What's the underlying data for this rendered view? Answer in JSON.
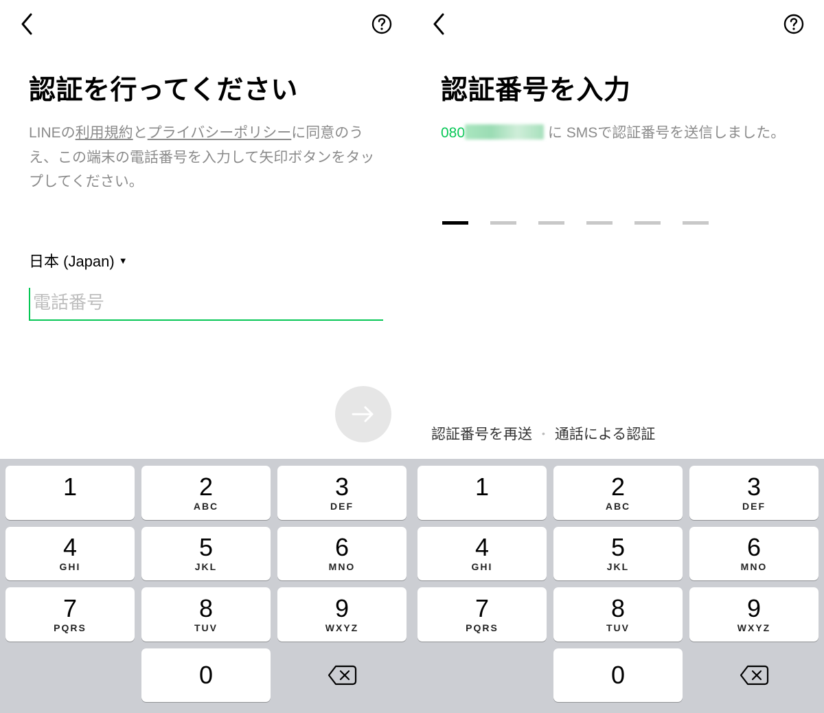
{
  "left": {
    "title": "認証を行ってください",
    "desc_prefix": "LINEの",
    "terms_link": "利用規約",
    "desc_and": "と",
    "privacy_link": "プライバシーポリシー",
    "desc_suffix": "に同意のうえ、この端末の電話番号を入力して矢印ボタンをタップしてください。",
    "country": "日本 (Japan)",
    "phone_placeholder": "電話番号"
  },
  "right": {
    "title": "認証番号を入力",
    "phone_prefix": "080",
    "desc_suffix": " に SMSで認証番号を送信しました。",
    "resend_link": "認証番号を再送",
    "call_link": "通話による認証"
  },
  "keypad": {
    "keys": [
      {
        "num": "1",
        "letters": ""
      },
      {
        "num": "2",
        "letters": "ABC"
      },
      {
        "num": "3",
        "letters": "DEF"
      },
      {
        "num": "4",
        "letters": "GHI"
      },
      {
        "num": "5",
        "letters": "JKL"
      },
      {
        "num": "6",
        "letters": "MNO"
      },
      {
        "num": "7",
        "letters": "PQRS"
      },
      {
        "num": "8",
        "letters": "TUV"
      },
      {
        "num": "9",
        "letters": "WXYZ"
      },
      {
        "num": "0",
        "letters": ""
      }
    ]
  }
}
